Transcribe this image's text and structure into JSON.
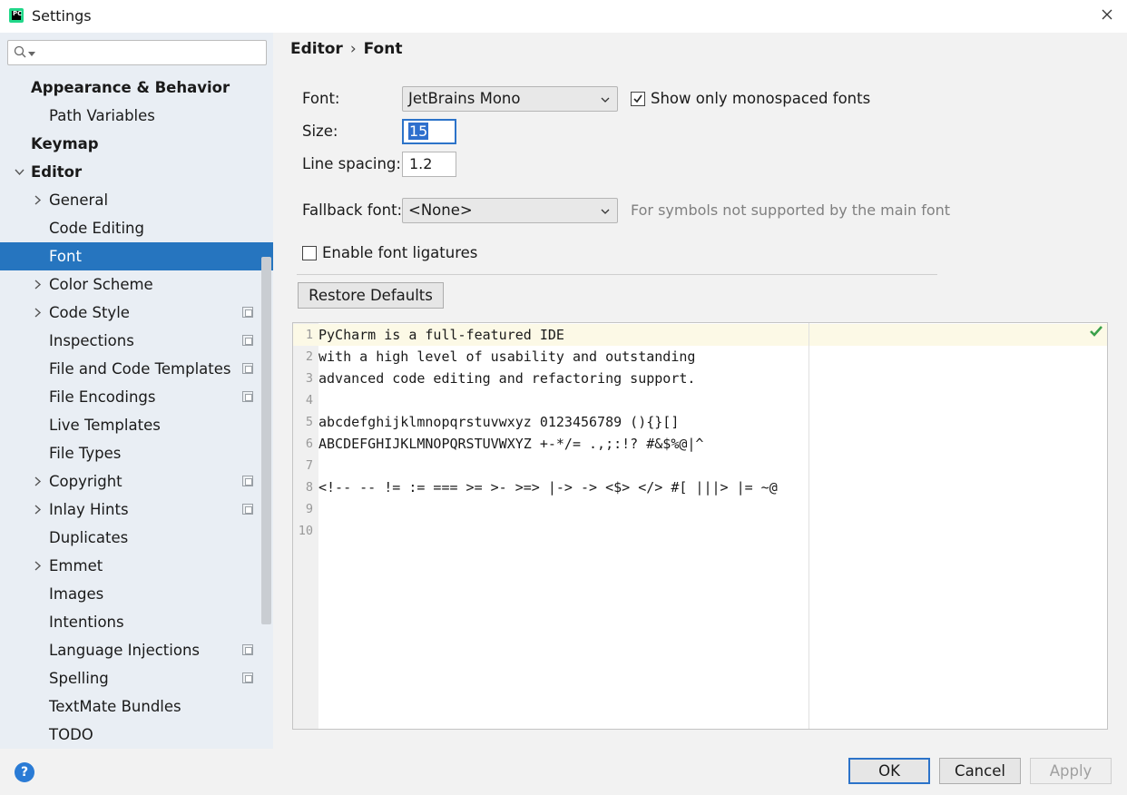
{
  "window": {
    "title": "Settings",
    "logo_text": "PC"
  },
  "search": {
    "placeholder": "",
    "value": ""
  },
  "sidebar": {
    "items": [
      {
        "label": "Appearance & Behavior",
        "bold": true,
        "arrow": "",
        "indent": 0
      },
      {
        "label": "Path Variables",
        "bold": false,
        "arrow": "",
        "indent": 1
      },
      {
        "label": "Keymap",
        "bold": true,
        "arrow": "",
        "indent": 0
      },
      {
        "label": "Editor",
        "bold": true,
        "arrow": "expanded",
        "indent": 0
      },
      {
        "label": "General",
        "bold": false,
        "arrow": "collapsed",
        "indent": 1
      },
      {
        "label": "Code Editing",
        "bold": false,
        "arrow": "",
        "indent": 1
      },
      {
        "label": "Font",
        "bold": false,
        "arrow": "",
        "indent": 1,
        "selected": true
      },
      {
        "label": "Color Scheme",
        "bold": false,
        "arrow": "collapsed",
        "indent": 1
      },
      {
        "label": "Code Style",
        "bold": false,
        "arrow": "collapsed",
        "indent": 1,
        "project_icon": true
      },
      {
        "label": "Inspections",
        "bold": false,
        "arrow": "",
        "indent": 1,
        "project_icon": true
      },
      {
        "label": "File and Code Templates",
        "bold": false,
        "arrow": "",
        "indent": 1,
        "project_icon": true
      },
      {
        "label": "File Encodings",
        "bold": false,
        "arrow": "",
        "indent": 1,
        "project_icon": true
      },
      {
        "label": "Live Templates",
        "bold": false,
        "arrow": "",
        "indent": 1
      },
      {
        "label": "File Types",
        "bold": false,
        "arrow": "",
        "indent": 1
      },
      {
        "label": "Copyright",
        "bold": false,
        "arrow": "collapsed",
        "indent": 1,
        "project_icon": true
      },
      {
        "label": "Inlay Hints",
        "bold": false,
        "arrow": "collapsed",
        "indent": 1,
        "project_icon": true
      },
      {
        "label": "Duplicates",
        "bold": false,
        "arrow": "",
        "indent": 1
      },
      {
        "label": "Emmet",
        "bold": false,
        "arrow": "collapsed",
        "indent": 1
      },
      {
        "label": "Images",
        "bold": false,
        "arrow": "",
        "indent": 1
      },
      {
        "label": "Intentions",
        "bold": false,
        "arrow": "",
        "indent": 1
      },
      {
        "label": "Language Injections",
        "bold": false,
        "arrow": "",
        "indent": 1,
        "project_icon": true
      },
      {
        "label": "Spelling",
        "bold": false,
        "arrow": "",
        "indent": 1,
        "project_icon": true
      },
      {
        "label": "TextMate Bundles",
        "bold": false,
        "arrow": "",
        "indent": 1
      },
      {
        "label": "TODO",
        "bold": false,
        "arrow": "",
        "indent": 1
      }
    ]
  },
  "breadcrumb": {
    "section": "Editor",
    "separator": "›",
    "page": "Font"
  },
  "form": {
    "font_label": "Font:",
    "font_value": "JetBrains Mono",
    "monospaced_label": "Show only monospaced fonts",
    "monospaced_checked": true,
    "size_label": "Size:",
    "size_value": "15",
    "line_spacing_label": "Line spacing:",
    "line_spacing_value": "1.2",
    "fallback_label": "Fallback font:",
    "fallback_value": "<None>",
    "fallback_hint": "For symbols not supported by the main font",
    "ligatures_label": "Enable font ligatures",
    "ligatures_checked": false,
    "restore_label": "Restore Defaults"
  },
  "preview": {
    "lines": [
      {
        "n": "1",
        "text": "PyCharm is a full-featured IDE"
      },
      {
        "n": "2",
        "text": "with a high level of usability and outstanding"
      },
      {
        "n": "3",
        "text": "advanced code editing and refactoring support."
      },
      {
        "n": "4",
        "text": ""
      },
      {
        "n": "5",
        "text": "abcdefghijklmnopqrstuvwxyz 0123456789 (){}[]"
      },
      {
        "n": "6",
        "text": "ABCDEFGHIJKLMNOPQRSTUVWXYZ +-*/= .,;:!? #&$%@|^"
      },
      {
        "n": "7",
        "text": ""
      },
      {
        "n": "8",
        "text": "<!-- -- != := === >= >- >=> |-> -> <$> </> #[ |||> |= ~@"
      },
      {
        "n": "9",
        "text": ""
      },
      {
        "n": "10",
        "text": ""
      }
    ],
    "status_icon": "check-icon",
    "caret_row_color": "#fcf9e6"
  },
  "footer": {
    "help_label": "?",
    "ok_label": "OK",
    "cancel_label": "Cancel",
    "apply_label": "Apply"
  },
  "colors": {
    "selection": "#2675bf",
    "sidebar_bg": "#e9eef4",
    "focus_border": "#2c73c9",
    "check_green": "#3aa04a"
  }
}
